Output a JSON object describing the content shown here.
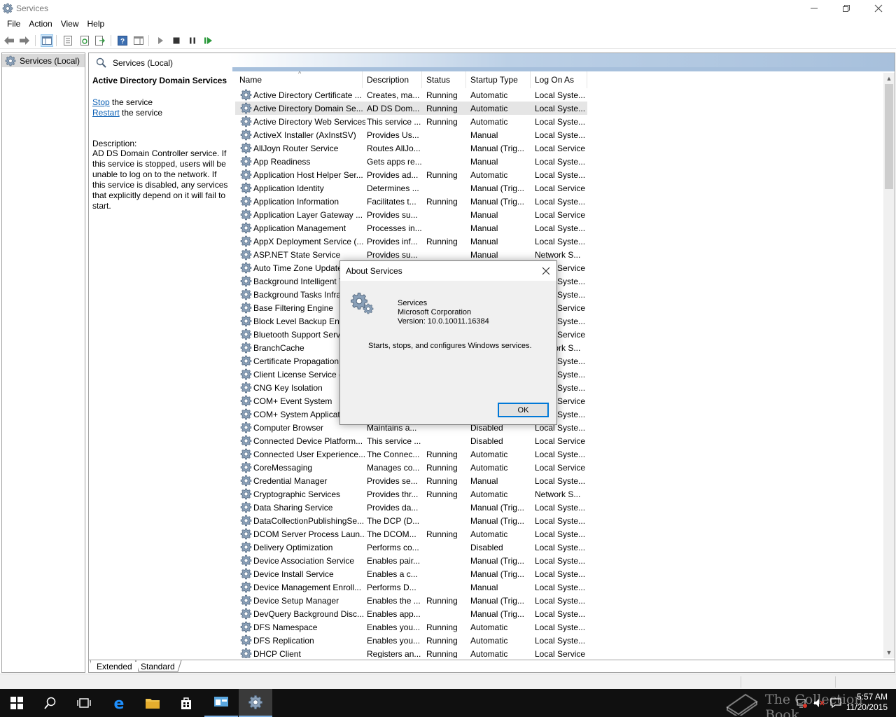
{
  "window": {
    "title": "Services"
  },
  "menu": [
    "File",
    "Action",
    "View",
    "Help"
  ],
  "tree": {
    "root_label": "Services (Local)"
  },
  "main_header": {
    "title": "Services (Local)"
  },
  "description_panel": {
    "service_name": "Active Directory Domain Services",
    "stop_link": "Stop",
    "stop_suffix": " the service",
    "restart_link": "Restart",
    "restart_suffix": " the service",
    "description_label": "Description:",
    "description_text": "AD DS Domain Controller service. If this service is stopped, users will be unable to log on to the network. If this service is disabled, any services that explicitly depend on it will fail to start."
  },
  "columns": [
    "Name",
    "Description",
    "Status",
    "Startup Type",
    "Log On As"
  ],
  "services": [
    {
      "name": "Active Directory Certificate ...",
      "description": "Creates, ma...",
      "status": "Running",
      "startup": "Automatic",
      "logon": "Local Syste..."
    },
    {
      "name": "Active Directory Domain Se...",
      "description": "AD DS Dom...",
      "status": "Running",
      "startup": "Automatic",
      "logon": "Local Syste..."
    },
    {
      "name": "Active Directory Web Services",
      "description": "This service ...",
      "status": "Running",
      "startup": "Automatic",
      "logon": "Local Syste..."
    },
    {
      "name": "ActiveX Installer (AxInstSV)",
      "description": "Provides Us...",
      "status": "",
      "startup": "Manual",
      "logon": "Local Syste..."
    },
    {
      "name": "AllJoyn Router Service",
      "description": "Routes AllJo...",
      "status": "",
      "startup": "Manual (Trig...",
      "logon": "Local Service"
    },
    {
      "name": "App Readiness",
      "description": "Gets apps re...",
      "status": "",
      "startup": "Manual",
      "logon": "Local Syste..."
    },
    {
      "name": "Application Host Helper Ser...",
      "description": "Provides ad...",
      "status": "Running",
      "startup": "Automatic",
      "logon": "Local Syste..."
    },
    {
      "name": "Application Identity",
      "description": "Determines ...",
      "status": "",
      "startup": "Manual (Trig...",
      "logon": "Local Service"
    },
    {
      "name": "Application Information",
      "description": "Facilitates t...",
      "status": "Running",
      "startup": "Manual (Trig...",
      "logon": "Local Syste..."
    },
    {
      "name": "Application Layer Gateway ...",
      "description": "Provides su...",
      "status": "",
      "startup": "Manual",
      "logon": "Local Service"
    },
    {
      "name": "Application Management",
      "description": "Processes in...",
      "status": "",
      "startup": "Manual",
      "logon": "Local Syste..."
    },
    {
      "name": "AppX Deployment Service (...",
      "description": "Provides inf...",
      "status": "Running",
      "startup": "Manual",
      "logon": "Local Syste..."
    },
    {
      "name": "ASP.NET State Service",
      "description": "Provides su...",
      "status": "",
      "startup": "Manual",
      "logon": "Network S..."
    },
    {
      "name": "Auto Time Zone Updater",
      "description": "",
      "status": "",
      "startup": "",
      "logon": "Local Service"
    },
    {
      "name": "Background Intelligent Transfer",
      "description": "",
      "status": "",
      "startup": "",
      "logon": "Local Syste..."
    },
    {
      "name": "Background Tasks Infrastructure",
      "description": "",
      "status": "",
      "startup": "",
      "logon": "Local Syste..."
    },
    {
      "name": "Base Filtering Engine",
      "description": "",
      "status": "",
      "startup": "",
      "logon": "Local Service"
    },
    {
      "name": "Block Level Backup Engine",
      "description": "",
      "status": "",
      "startup": "",
      "logon": "Local Syste..."
    },
    {
      "name": "Bluetooth Support Service",
      "description": "",
      "status": "",
      "startup": "",
      "logon": "Local Service"
    },
    {
      "name": "BranchCache",
      "description": "",
      "status": "",
      "startup": "",
      "logon": "Network S..."
    },
    {
      "name": "Certificate Propagation",
      "description": "",
      "status": "",
      "startup": "",
      "logon": "Local Syste..."
    },
    {
      "name": "Client License Service (ClipSVC)",
      "description": "",
      "status": "",
      "startup": "",
      "logon": "Local Syste..."
    },
    {
      "name": "CNG Key Isolation",
      "description": "",
      "status": "",
      "startup": "",
      "logon": "Local Syste..."
    },
    {
      "name": "COM+ Event System",
      "description": "",
      "status": "",
      "startup": "",
      "logon": "Local Service"
    },
    {
      "name": "COM+ System Application",
      "description": "",
      "status": "",
      "startup": "",
      "logon": "Local Syste..."
    },
    {
      "name": "Computer Browser",
      "description": "Maintains a...",
      "status": "",
      "startup": "Disabled",
      "logon": "Local Syste..."
    },
    {
      "name": "Connected Device Platform...",
      "description": "This service ...",
      "status": "",
      "startup": "Disabled",
      "logon": "Local Service"
    },
    {
      "name": "Connected User Experience...",
      "description": "The Connec...",
      "status": "Running",
      "startup": "Automatic",
      "logon": "Local Syste..."
    },
    {
      "name": "CoreMessaging",
      "description": "Manages co...",
      "status": "Running",
      "startup": "Automatic",
      "logon": "Local Service"
    },
    {
      "name": "Credential Manager",
      "description": "Provides se...",
      "status": "Running",
      "startup": "Manual",
      "logon": "Local Syste..."
    },
    {
      "name": "Cryptographic Services",
      "description": "Provides thr...",
      "status": "Running",
      "startup": "Automatic",
      "logon": "Network S..."
    },
    {
      "name": "Data Sharing Service",
      "description": "Provides da...",
      "status": "",
      "startup": "Manual (Trig...",
      "logon": "Local Syste..."
    },
    {
      "name": "DataCollectionPublishingSe...",
      "description": "The DCP (D...",
      "status": "",
      "startup": "Manual (Trig...",
      "logon": "Local Syste..."
    },
    {
      "name": "DCOM Server Process Laun...",
      "description": "The DCOM...",
      "status": "Running",
      "startup": "Automatic",
      "logon": "Local Syste..."
    },
    {
      "name": "Delivery Optimization",
      "description": "Performs co...",
      "status": "",
      "startup": "Disabled",
      "logon": "Local Syste..."
    },
    {
      "name": "Device Association Service",
      "description": "Enables pair...",
      "status": "",
      "startup": "Manual (Trig...",
      "logon": "Local Syste..."
    },
    {
      "name": "Device Install Service",
      "description": "Enables a c...",
      "status": "",
      "startup": "Manual (Trig...",
      "logon": "Local Syste..."
    },
    {
      "name": "Device Management Enroll...",
      "description": "Performs D...",
      "status": "",
      "startup": "Manual",
      "logon": "Local Syste..."
    },
    {
      "name": "Device Setup Manager",
      "description": "Enables the ...",
      "status": "Running",
      "startup": "Manual (Trig...",
      "logon": "Local Syste..."
    },
    {
      "name": "DevQuery Background Disc...",
      "description": "Enables app...",
      "status": "",
      "startup": "Manual (Trig...",
      "logon": "Local Syste..."
    },
    {
      "name": "DFS Namespace",
      "description": "Enables you...",
      "status": "Running",
      "startup": "Automatic",
      "logon": "Local Syste..."
    },
    {
      "name": "DFS Replication",
      "description": "Enables you...",
      "status": "Running",
      "startup": "Automatic",
      "logon": "Local Syste..."
    },
    {
      "name": "DHCP Client",
      "description": "Registers an...",
      "status": "Running",
      "startup": "Automatic",
      "logon": "Local Service"
    }
  ],
  "tabs": [
    "Extended",
    "Standard"
  ],
  "dialog": {
    "title": "About Services",
    "product": "Services",
    "company": "Microsoft Corporation",
    "version": "Version: 10.0.10011.16384",
    "description": "Starts, stops, and configures Windows services.",
    "ok_label": "OK"
  },
  "taskbar": {
    "time": "5:57 AM",
    "date": "11/20/2015",
    "watermark": "The Collection Book"
  },
  "colors": {
    "accent": "#0078d7",
    "link": "#0a5fb4",
    "header_gradient": "#a7c0dc",
    "taskbar": "#101010"
  }
}
